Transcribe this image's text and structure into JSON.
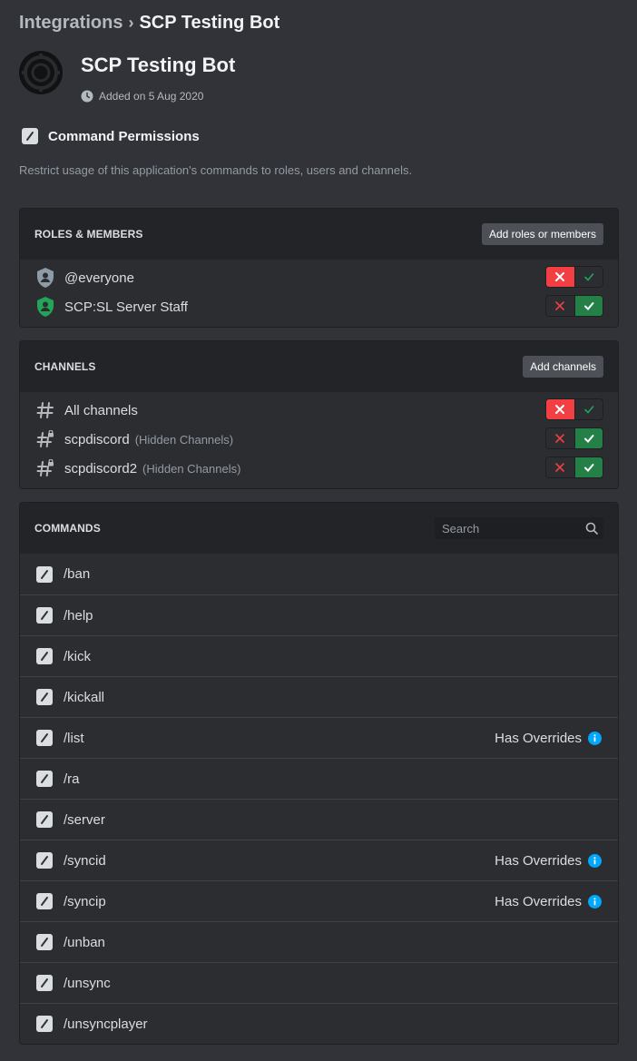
{
  "breadcrumb": {
    "parent": "Integrations",
    "separator": "›",
    "current": "SCP Testing Bot"
  },
  "app": {
    "name": "SCP Testing Bot",
    "added": "Added on 5 Aug 2020"
  },
  "permissions": {
    "title": "Command Permissions",
    "description": "Restrict usage of this application's commands to roles, users and channels."
  },
  "roles_panel": {
    "title": "ROLES & MEMBERS",
    "add_button": "Add roles or members",
    "items": [
      {
        "label": "@everyone",
        "state": "deny",
        "icon": "role-icon",
        "icon_color": "#8d9ba6"
      },
      {
        "label": "SCP:SL Server Staff",
        "state": "allow",
        "icon": "role-icon",
        "icon_color": "#23a559"
      }
    ]
  },
  "channels_panel": {
    "title": "CHANNELS",
    "add_button": "Add channels",
    "items": [
      {
        "label": "All channels",
        "sub": "",
        "state": "deny",
        "icon": "hash-icon"
      },
      {
        "label": "scpdiscord",
        "sub": "(Hidden Channels)",
        "state": "allow",
        "icon": "locked-hash-icon"
      },
      {
        "label": "scpdiscord2",
        "sub": "(Hidden Channels)",
        "state": "allow",
        "icon": "locked-hash-icon"
      }
    ]
  },
  "commands_panel": {
    "title": "COMMANDS",
    "search_placeholder": "Search",
    "overrides_label": "Has Overrides",
    "items": [
      {
        "label": "/ban",
        "overrides": false
      },
      {
        "label": "/help",
        "overrides": false
      },
      {
        "label": "/kick",
        "overrides": false
      },
      {
        "label": "/kickall",
        "overrides": false
      },
      {
        "label": "/list",
        "overrides": true
      },
      {
        "label": "/ra",
        "overrides": false
      },
      {
        "label": "/server",
        "overrides": false
      },
      {
        "label": "/syncid",
        "overrides": true
      },
      {
        "label": "/syncip",
        "overrides": true
      },
      {
        "label": "/unban",
        "overrides": false
      },
      {
        "label": "/unsync",
        "overrides": false
      },
      {
        "label": "/unsyncplayer",
        "overrides": false
      }
    ]
  },
  "colors": {
    "deny": "#f23f43",
    "allow": "#248046",
    "info": "#00a8fc",
    "background": "#313338"
  }
}
